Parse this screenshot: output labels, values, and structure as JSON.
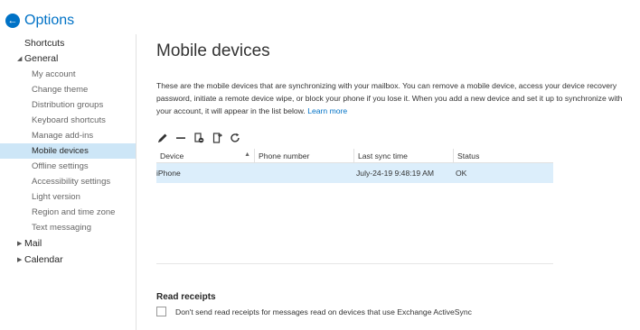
{
  "header": {
    "title": "Options",
    "back_icon": "back-arrow-icon"
  },
  "sidebar": {
    "items": [
      {
        "label": "Shortcuts",
        "level": "top",
        "caret": ""
      },
      {
        "label": "General",
        "level": "top",
        "caret": "◢"
      },
      {
        "label": "My account",
        "level": "sub"
      },
      {
        "label": "Change theme",
        "level": "sub"
      },
      {
        "label": "Distribution groups",
        "level": "sub"
      },
      {
        "label": "Keyboard shortcuts",
        "level": "sub"
      },
      {
        "label": "Manage add-ins",
        "level": "sub"
      },
      {
        "label": "Mobile devices",
        "level": "sub",
        "selected": true
      },
      {
        "label": "Offline settings",
        "level": "sub"
      },
      {
        "label": "Accessibility settings",
        "level": "sub"
      },
      {
        "label": "Light version",
        "level": "sub"
      },
      {
        "label": "Region and time zone",
        "level": "sub"
      },
      {
        "label": "Text messaging",
        "level": "sub"
      },
      {
        "label": "Mail",
        "level": "top",
        "caret": "▶"
      },
      {
        "label": "Calendar",
        "level": "top",
        "caret": "▶"
      }
    ]
  },
  "main": {
    "title": "Mobile devices",
    "description": "These are the mobile devices that are synchronizing with your mailbox. You can remove a mobile device, access your device recovery password, initiate a remote device wipe, or block your phone if you lose it. When you add a new device and set it up to synchronize with your account, it will appear in the list below.",
    "learn_more": "Learn more",
    "toolbar": [
      "edit-icon",
      "remove-icon",
      "block-icon",
      "wipe-icon",
      "refresh-icon"
    ],
    "table": {
      "columns": [
        "Device",
        "Phone number",
        "Last sync time",
        "Status"
      ],
      "sort_indicator": "▲",
      "rows": [
        {
          "device": "iPhone",
          "phone": "",
          "last_sync": "July-24-19 9:48:19 AM",
          "status": "OK"
        }
      ]
    },
    "read_receipts": {
      "title": "Read receipts",
      "checkbox_label": "Don't send read receipts for messages read on devices that use Exchange ActiveSync",
      "checked": false
    }
  },
  "colors": {
    "accent": "#0072c6",
    "selected_bg": "#cde6f7",
    "row_highlight": "#dceefb"
  }
}
